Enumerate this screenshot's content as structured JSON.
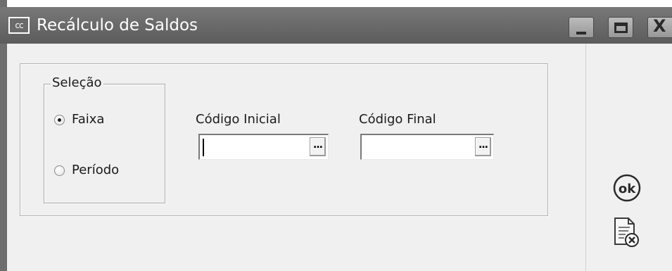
{
  "window": {
    "title": "Recálculo de Saldos",
    "app_icon_text": "cc",
    "controls": {
      "minimize": "minimize",
      "maximize": "maximize",
      "close": "X"
    }
  },
  "selection": {
    "legend": "Seleção",
    "options": [
      {
        "label": "Faixa",
        "checked": true
      },
      {
        "label": "Período",
        "checked": false
      }
    ]
  },
  "fields": {
    "inicial": {
      "label": "Código Inicial",
      "value": "",
      "button": "..."
    },
    "final": {
      "label": "Código Final",
      "value": "",
      "button": "..."
    }
  },
  "actions": {
    "ok_label": "ok",
    "ok_icon": "ok-circle-icon",
    "cancel_icon": "document-cancel-icon"
  },
  "colors": {
    "titlebar": "#6a6a6a",
    "content_bg": "#f0f0f0"
  }
}
